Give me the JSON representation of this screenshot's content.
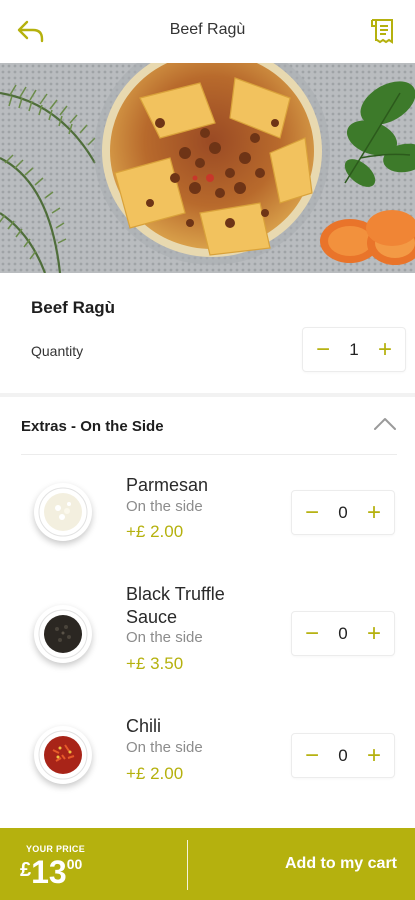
{
  "header": {
    "title": "Beef Ragù",
    "back_icon": "back-arrow-icon",
    "receipt_icon": "receipt-icon"
  },
  "colors": {
    "accent": "#b5b10e",
    "text_dark": "#1e1e1e",
    "text_muted": "#8c8c8c"
  },
  "dish": {
    "name": "Beef Ragù",
    "quantity_label": "Quantity",
    "quantity": "1",
    "minus_symbol": "−",
    "plus_symbol": "+"
  },
  "extras": {
    "title": "Extras - On the Side",
    "collapse_icon": "chevron-up-icon",
    "items": [
      {
        "name": "Parmesan",
        "subtitle": "On the side",
        "price": "+£ 2.00",
        "quantity": "0",
        "minus_symbol": "−",
        "plus_symbol": "+",
        "icon": "parmesan-bowl-icon"
      },
      {
        "name": "Black Truffle Sauce",
        "subtitle": "On the side",
        "price": "+£ 3.50",
        "quantity": "0",
        "minus_symbol": "−",
        "plus_symbol": "+",
        "icon": "truffle-sauce-bowl-icon"
      },
      {
        "name": "Chili",
        "subtitle": "On the side",
        "price": "+£ 2.00",
        "quantity": "0",
        "minus_symbol": "−",
        "plus_symbol": "+",
        "icon": "chili-bowl-icon"
      }
    ]
  },
  "footer": {
    "price_caption": "YOUR PRICE",
    "currency": "£",
    "price_main": "13",
    "price_cents": "00",
    "add_to_cart": "Add to my cart"
  }
}
